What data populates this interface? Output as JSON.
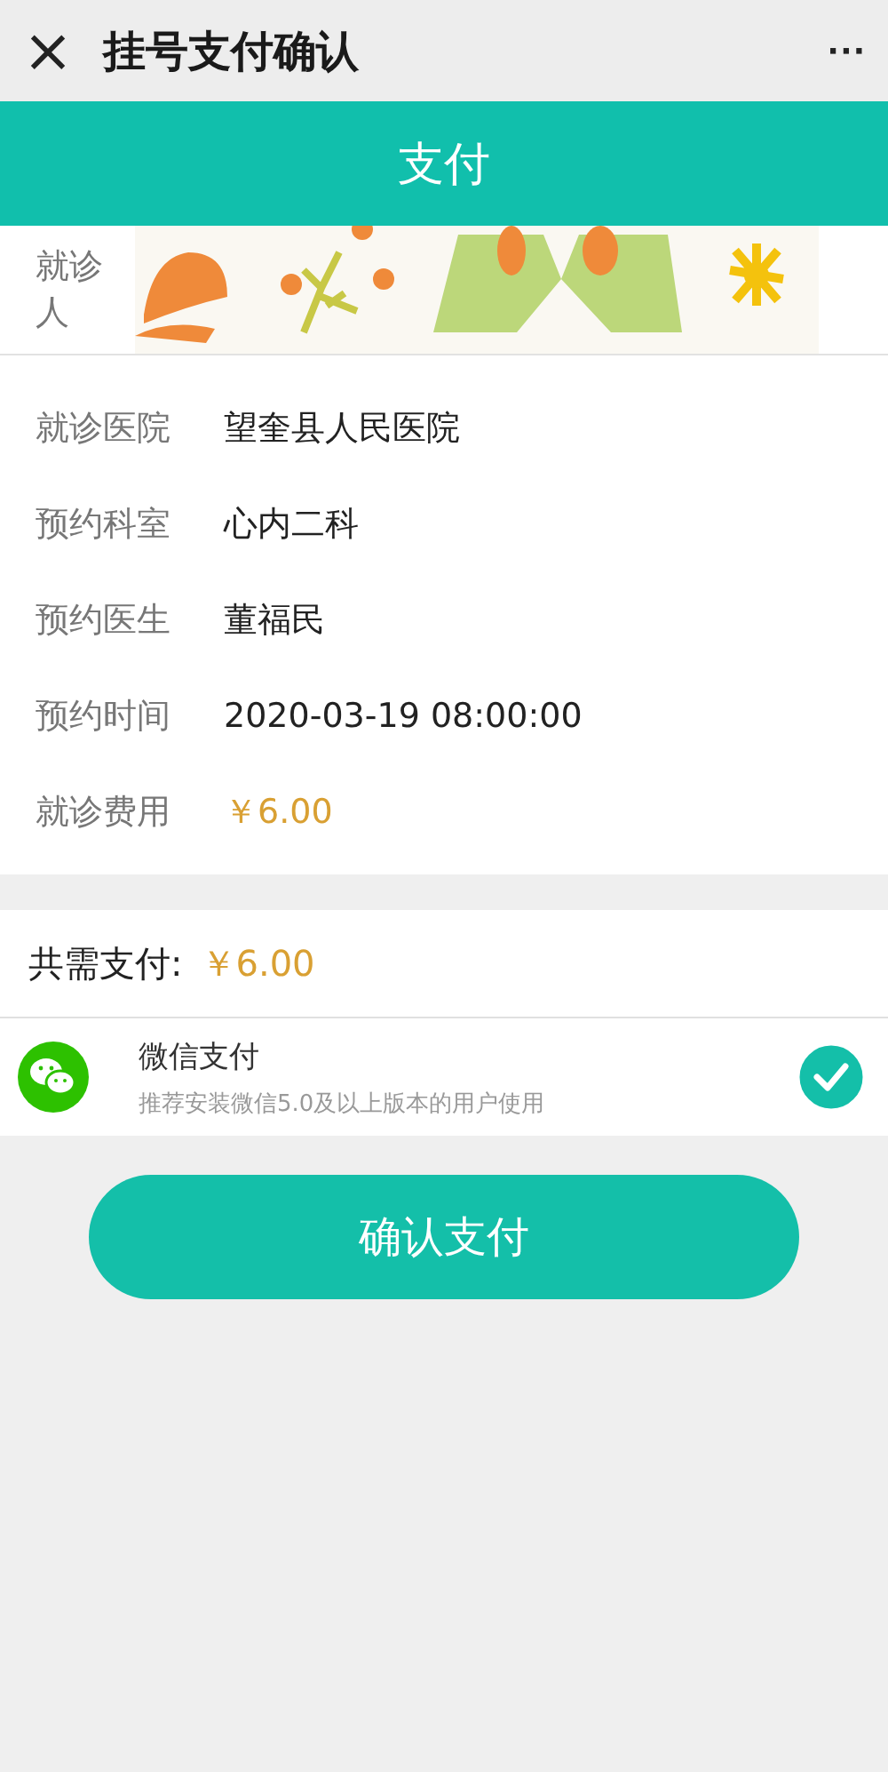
{
  "header": {
    "close": "×",
    "title": "挂号支付确认",
    "menu": "···"
  },
  "banner": {
    "title": "支付"
  },
  "patient": {
    "label": "就诊人",
    "kind": "picture"
  },
  "details": [
    {
      "label": "就诊医院",
      "value": "望奎县人民医院",
      "kind": "plain"
    },
    {
      "label": "预约科室",
      "value": "心内二科",
      "kind": "plain"
    },
    {
      "label": "预约医生",
      "value": "董福民",
      "kind": "plain"
    },
    {
      "label": "预约时间",
      "value": "2020-03-19 08:00:00",
      "kind": "plain"
    },
    {
      "label": "就诊费用",
      "value": "￥6.00",
      "kind": "price"
    }
  ],
  "total": {
    "label": "共需支付:",
    "value": "￥6.00"
  },
  "payment_methods": [
    {
      "name": "微信支付",
      "note": "推荐安装微信5.0及以上版本的用户使用",
      "selected": true
    }
  ],
  "confirm_button": "确认支付"
}
